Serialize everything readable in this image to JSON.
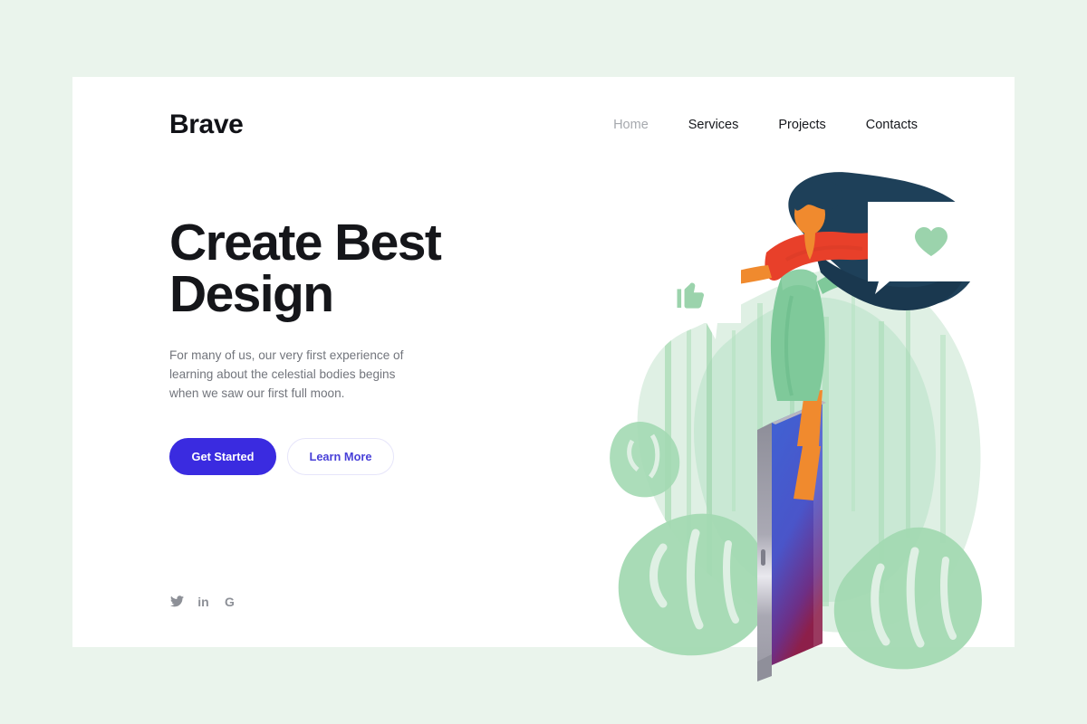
{
  "site": {
    "background_color": "#eaf4ec",
    "card_color": "#ffffff",
    "accent_color": "#3a2be0"
  },
  "header": {
    "logo": "Brave",
    "nav": [
      {
        "label": "Home",
        "state": "muted"
      },
      {
        "label": "Services",
        "state": "default"
      },
      {
        "label": "Projects",
        "state": "default"
      },
      {
        "label": "Contacts",
        "state": "default"
      }
    ]
  },
  "hero": {
    "headline": "Create Best Design",
    "paragraph": "For many of us, our very first experience of learning about the celestial bodies begins when we saw our first full moon.",
    "primary_button": "Get Started",
    "secondary_button": "Learn More"
  },
  "social": {
    "items": [
      {
        "icon": "twitter-icon",
        "label": "Twitter"
      },
      {
        "icon": "linkedin-icon",
        "label": "in"
      },
      {
        "icon": "google-icon",
        "label": "G"
      }
    ]
  },
  "illustration": {
    "name": "woman-standing-on-phone-with-feedback-bubbles",
    "colors": {
      "blob_green": "#d8ece0",
      "leaf_green": "#a9dcb6",
      "hair_navy": "#1e4059",
      "top_red": "#e8402a",
      "skin_orange": "#f08a2e",
      "pants_green": "#7fc99a",
      "screen_blue": "#3a5fd0",
      "screen_purple": "#7b2f8c",
      "frame_gray": "#9a9aa4",
      "bubble_white": "#ffffff",
      "bubble_icon_green": "#9bd3ac"
    },
    "bubbles": [
      {
        "icon": "thumbs-up-icon"
      },
      {
        "icon": "heart-icon"
      }
    ]
  }
}
